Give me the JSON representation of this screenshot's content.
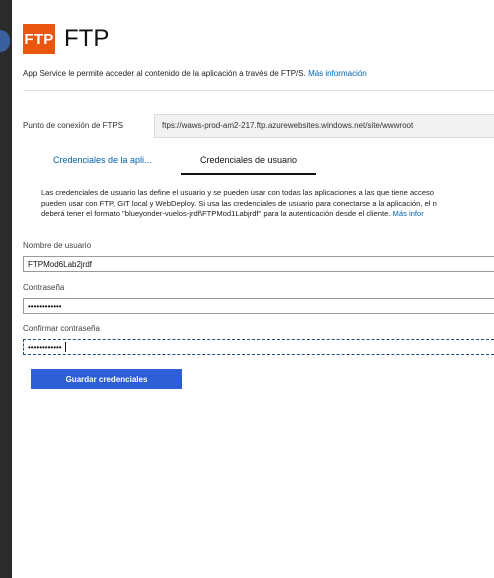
{
  "header": {
    "logo_text": "FTP",
    "title": "FTP"
  },
  "intro": {
    "text": "App Service le permite acceder al contenido de la aplicación a través de FTP/S.",
    "link": "Más información"
  },
  "endpoint": {
    "label": "Punto de conexión de FTPS",
    "value": "ftps://waws-prod-am2-217.ftp.azurewebsites.windows.net/site/wwwroot"
  },
  "tabs": [
    {
      "label": "Credenciales de la apli...",
      "active": false
    },
    {
      "label": "Credenciales de usuario",
      "active": true
    }
  ],
  "description": {
    "line1": "Las credenciales de usuario las define el usuario y se pueden usar con todas las aplicaciones a las que tiene acceso",
    "line2": "pueden usar con FTP, GIT local y WebDeploy. Si usa las credenciales de usuario para conectarse a la aplicación, el n",
    "line3": "deberá tener el formato \"blueyonder-vuelos-jrdf\\FTPMod1Labjrdf\" para la autenticación desde el cliente.",
    "link": "Más infor"
  },
  "form": {
    "username_label": "Nombre de usuario",
    "username_value": "FTPMod6Lab2jrdf",
    "password_label": "Contraseña",
    "password_value": "••••••••••••",
    "confirm_label": "Confirmar contraseña",
    "confirm_value": "••••••••••••"
  },
  "save_button": "Guardar credenciales",
  "colors": {
    "logo": "#e8560f",
    "link": "#0063b1",
    "button": "#2f5fd6"
  }
}
